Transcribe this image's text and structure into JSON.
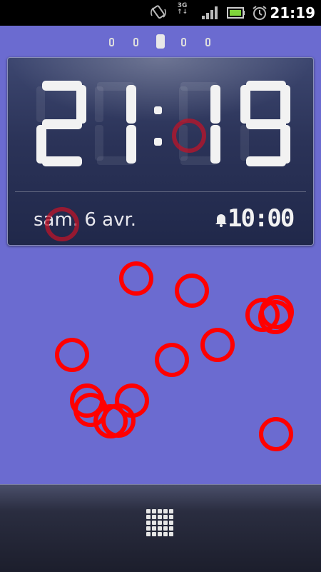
{
  "status_bar": {
    "time": "21:19",
    "network": "3G",
    "icons": [
      "rotation-icon",
      "network-3g-icon",
      "signal-icon",
      "battery-icon",
      "alarm-clock-icon"
    ]
  },
  "home_pager": {
    "pages": 5,
    "active_page": 3
  },
  "clock_widget": {
    "time": "21:19",
    "date": "sam. 6 avr.",
    "alarm": "10:00"
  },
  "dock": {
    "apps_button": "apps-grid-icon"
  },
  "overlay": {
    "touch_markers": 18,
    "color": "#ff0000"
  },
  "colors": {
    "wallpaper": "#6b6bd0",
    "statusbar": "#000000",
    "widget": "#2b3358"
  }
}
